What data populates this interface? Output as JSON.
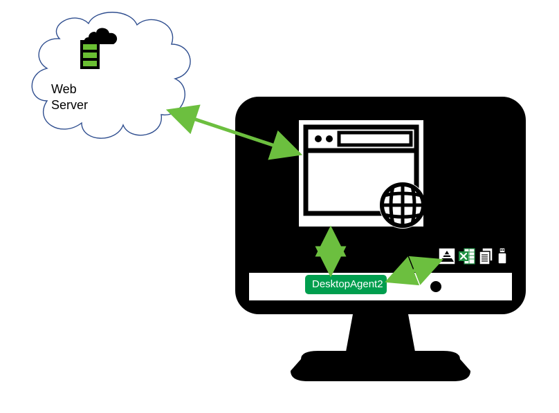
{
  "diagram": {
    "cloud_label_line1": "Web",
    "cloud_label_line2": "Server",
    "agent_badge": "DesktopAgent2",
    "colors": {
      "arrow": "#6CBF3F",
      "badge_bg": "#009E4E",
      "excel_green": "#1D8F42",
      "cloud_stroke": "#2F4E8F",
      "server_bar": "#6ABF33"
    },
    "taskbar_icons": [
      "scanner-icon",
      "excel-icon",
      "documents-icon",
      "usb-icon"
    ]
  }
}
